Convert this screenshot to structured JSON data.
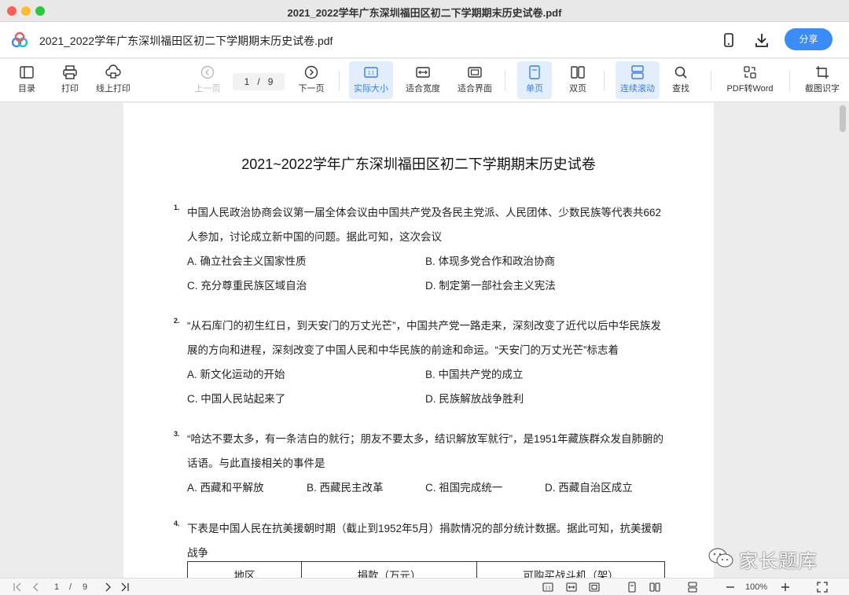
{
  "window": {
    "title": "2021_2022学年广东深圳福田区初二下学期期末历史试卷.pdf"
  },
  "appbar": {
    "doc_title": "2021_2022学年广东深圳福田区初二下学期期末历史试卷.pdf",
    "share_label": "分享"
  },
  "toolbar": {
    "toc": "目录",
    "print": "打印",
    "online_print": "线上打印",
    "prev": "上一页",
    "page_current": "1",
    "page_sep": "/",
    "page_total": "9",
    "next": "下一页",
    "actual_size": "实际大小",
    "fit_width": "适合宽度",
    "fit_page": "适合界面",
    "single": "单页",
    "double": "双页",
    "continuous": "连续滚动",
    "search": "查找",
    "pdf_to_word": "PDF转Word",
    "ocr": "截图识字"
  },
  "document": {
    "title": "2021~2022学年广东深圳福田区初二下学期期末历史试卷",
    "questions": [
      {
        "num": "1.",
        "lines": [
          "中国人民政治协商会议第一届全体会议由中国共产党及各民主党派、人民团体、少数民族等代表共662",
          "人参加，讨论成立新中国的问题。据此可知，这次会议"
        ],
        "options": [
          "A. 确立社会主义国家性质",
          "B. 体现多党合作和政治协商",
          "C. 充分尊重民族区域自治",
          "D. 制定第一部社会主义宪法"
        ]
      },
      {
        "num": "2.",
        "lines": [
          "“从石库门的初生红日，到天安门的万丈光芒”，中国共产党一路走来，深刻改变了近代以后中华民族发",
          "展的方向和进程，深刻改变了中国人民和中华民族的前途和命运。“天安门的万丈光芒”标志着"
        ],
        "options": [
          "A. 新文化运动的开始",
          "B. 中国共产党的成立",
          "C. 中国人民站起来了",
          "D. 民族解放战争胜利"
        ]
      },
      {
        "num": "3.",
        "lines": [
          "“哈达不要太多，有一条洁白的就行；朋友不要太多，结识解放军就行”，是1951年藏族群众发自肺腑的",
          "话语。与此直接相关的事件是"
        ],
        "options": [
          "A. 西藏和平解放",
          "B. 西藏民主改革",
          "C. 祖国完成统一",
          "D. 西藏自治区成立"
        ]
      },
      {
        "num": "4.",
        "lines": [
          "下表是中国人民在抗美援朝时期（截止到1952年5月）捐款情况的部分统计数据。据此可知，抗美援朝",
          "战争"
        ],
        "table_headers": [
          "地区",
          "捐款（万元）",
          "可购买战斗机（架）"
        ]
      }
    ]
  },
  "statusbar": {
    "page_current": "1",
    "page_sep": "/",
    "page_total": "9",
    "zoom": "100%"
  },
  "watermark": {
    "text": "家长题库"
  },
  "colors": {
    "accent": "#3b8cf7",
    "active_bg": "#e3eefc"
  }
}
